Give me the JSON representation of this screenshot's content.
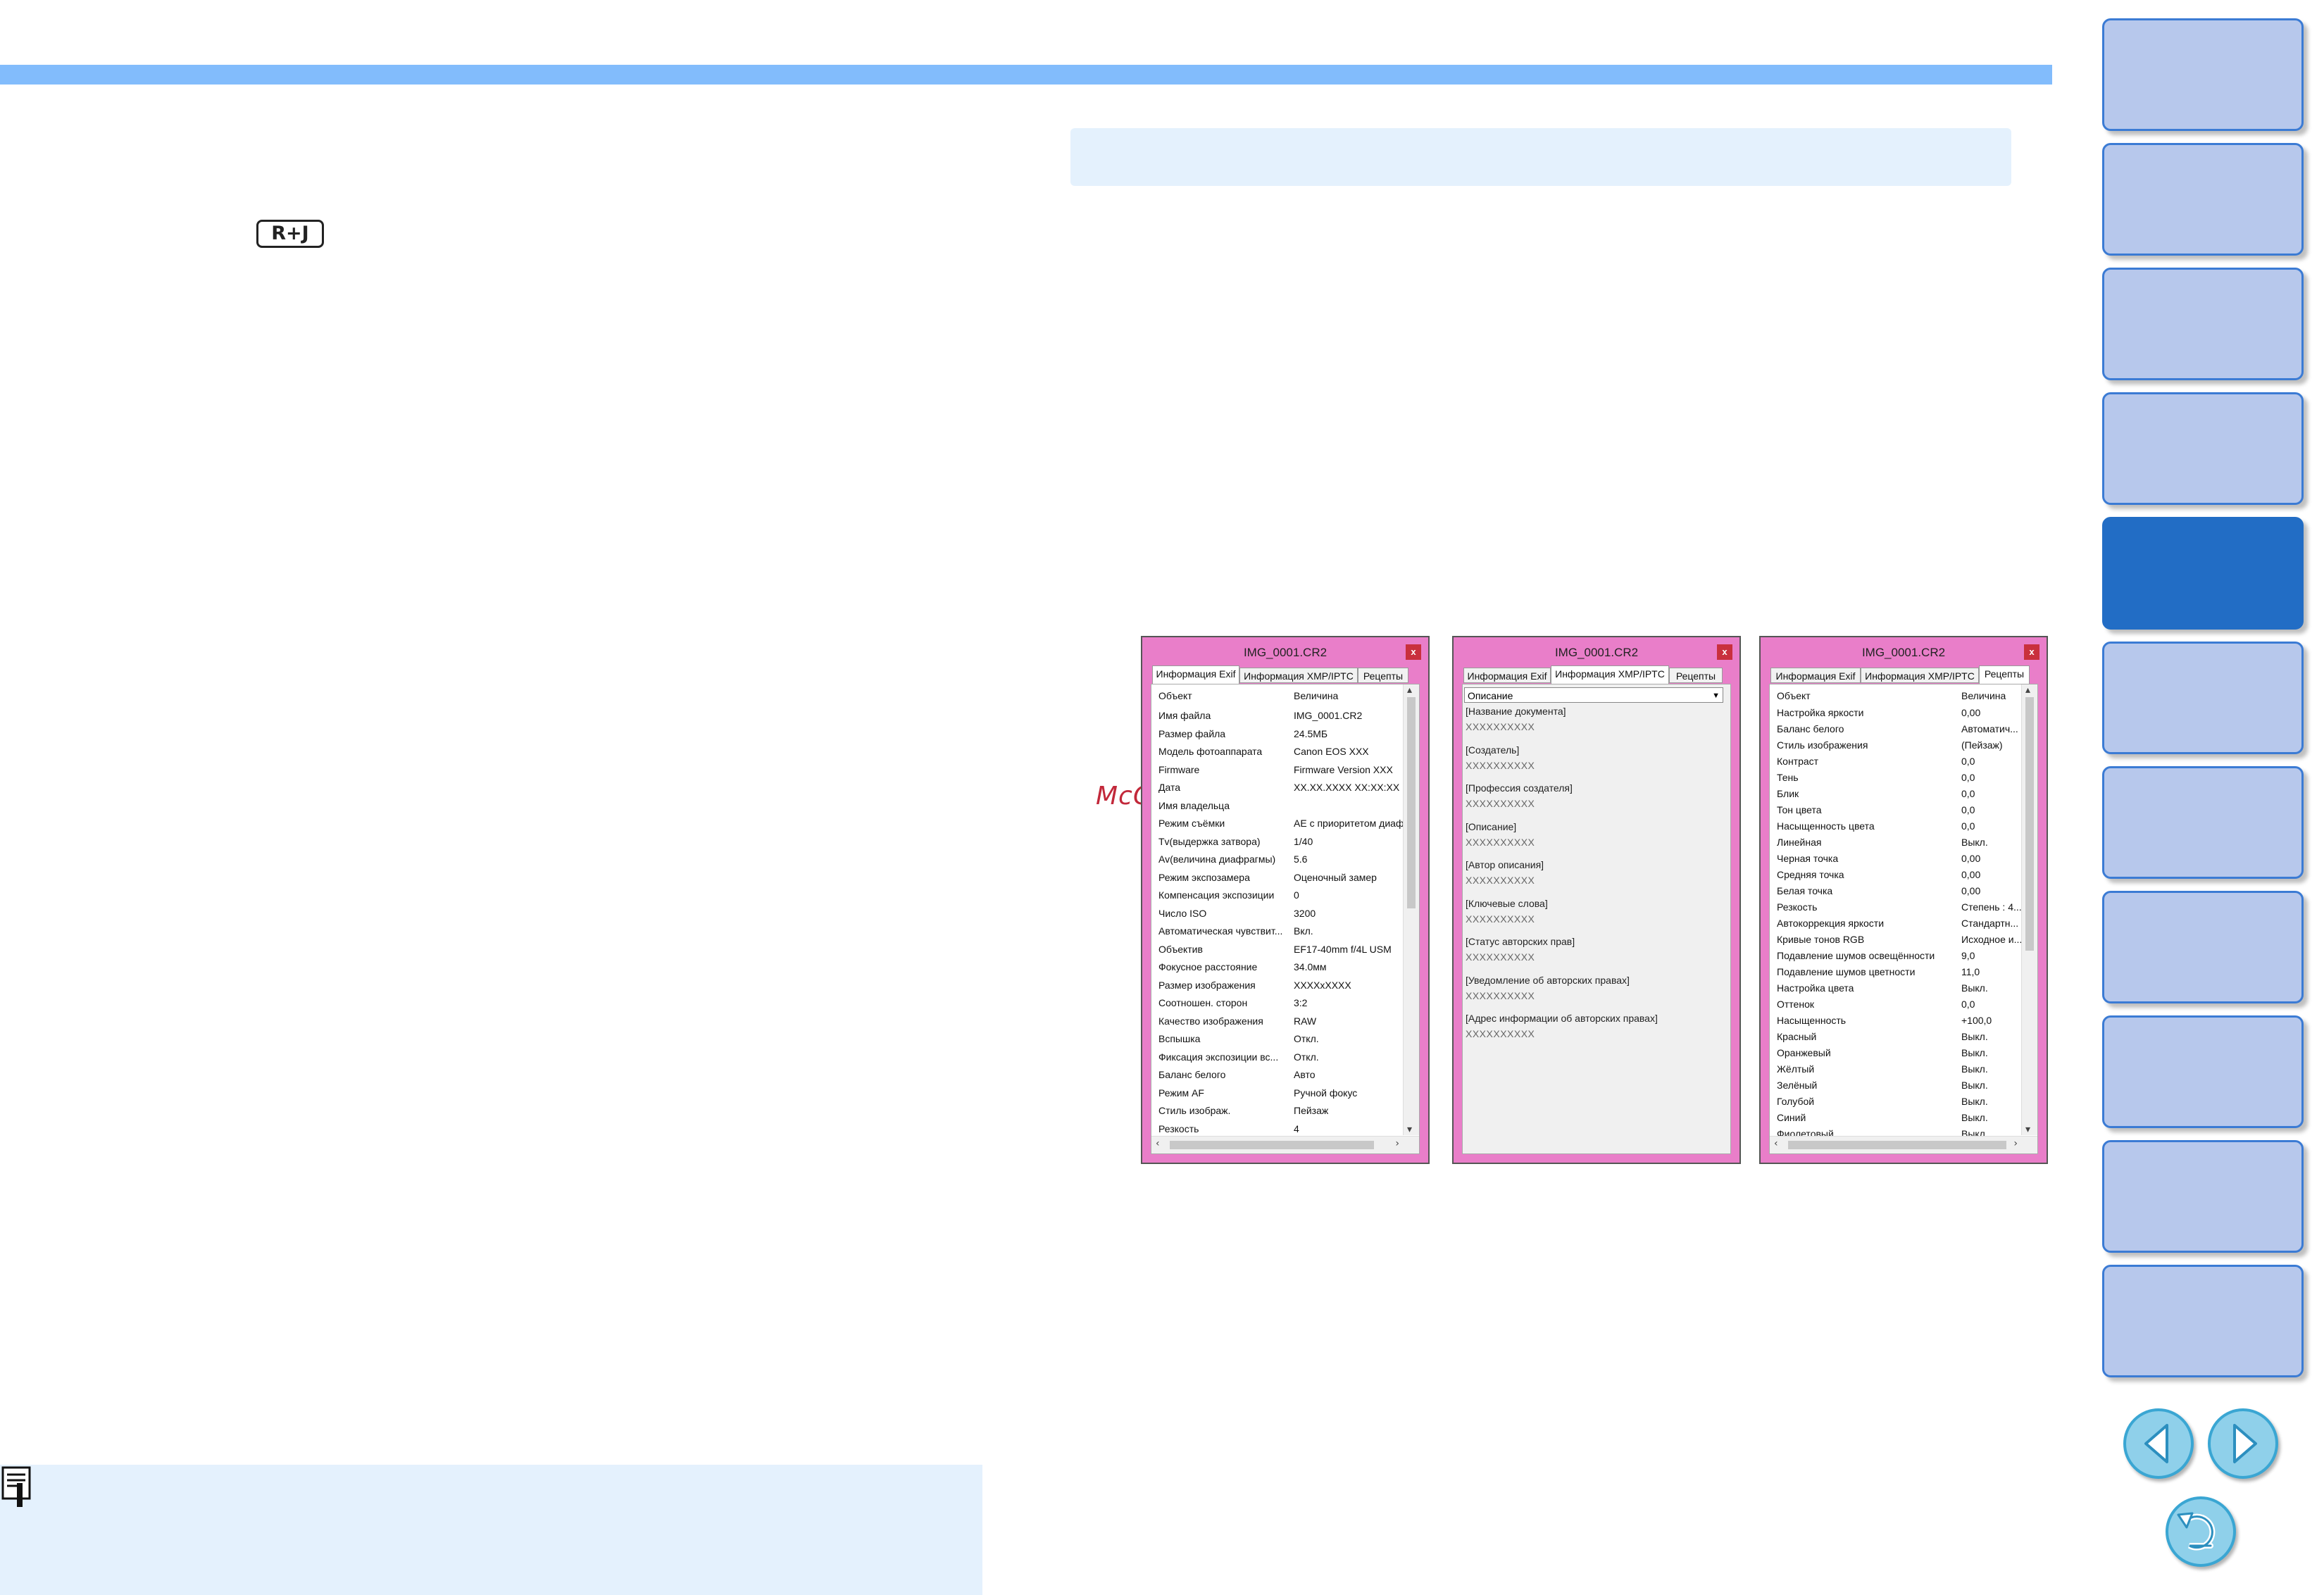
{
  "page": {
    "badge_label": "R+J",
    "watermark": "McGrp.Ru"
  },
  "colors": {
    "top_bar": "#82bcfc",
    "dialog_frame": "#e97ec9",
    "sidebar_button": "#b7c8ec",
    "sidebar_button_active": "#226dc5",
    "note_background": "#e4f1fd"
  },
  "sidebar": {
    "button_count": 11,
    "active_index": 4
  },
  "dialogs": {
    "exif": {
      "title": "IMG_0001.CR2",
      "close": "x",
      "tabs": [
        "Информация Exif",
        "Информация XMP/IPTC",
        "Рецепты"
      ],
      "header_key": "Объект",
      "header_value": "Величина",
      "rows": [
        {
          "k": "Имя файла",
          "v": "IMG_0001.CR2"
        },
        {
          "k": "Размер файла",
          "v": "24.5МБ"
        },
        {
          "k": "Модель фотоаппарата",
          "v": "Canon EOS XXX"
        },
        {
          "k": "Firmware",
          "v": "Firmware Version XXX"
        },
        {
          "k": "Дата",
          "v": "XX.XX.XXXX XX:XX:XX"
        },
        {
          "k": "Имя владельца",
          "v": ""
        },
        {
          "k": "Режим съёмки",
          "v": "AE с приоритетом диафр."
        },
        {
          "k": "Tv(выдержка затвора)",
          "v": "1/40"
        },
        {
          "k": "Av(величина диафрагмы)",
          "v": "5.6"
        },
        {
          "k": "Режим экспозамера",
          "v": "Оценочный замер"
        },
        {
          "k": "Компенсация экспозиции",
          "v": "0"
        },
        {
          "k": "Число ISO",
          "v": "3200"
        },
        {
          "k": "Автоматическая чувствит...",
          "v": "Вкл."
        },
        {
          "k": "Объектив",
          "v": "EF17-40mm f/4L USM"
        },
        {
          "k": "Фокусное расстояние",
          "v": "34.0мм"
        },
        {
          "k": "Размер изображения",
          "v": "XXXXxXXXX"
        },
        {
          "k": "Соотношен. сторон",
          "v": "3:2"
        },
        {
          "k": "Качество изображения",
          "v": "RAW"
        },
        {
          "k": "Вспышка",
          "v": "Откл."
        },
        {
          "k": "Фиксация экспозиции вс...",
          "v": "Откл."
        },
        {
          "k": "Баланс белого",
          "v": "Авто"
        },
        {
          "k": "Режим AF",
          "v": "Ручной фокус"
        },
        {
          "k": "Стиль изображ.",
          "v": "Пейзаж"
        },
        {
          "k": "Резкость",
          "v": "4"
        }
      ]
    },
    "xmp": {
      "title": "IMG_0001.CR2",
      "close": "x",
      "tabs": [
        "Информация Exif",
        "Информация XMP/IPTC",
        "Рецепты"
      ],
      "select_value": "Описание",
      "items": [
        {
          "t": "[Название документа]",
          "x": "XXXXXXXXXX"
        },
        {
          "t": "[Создатель]",
          "x": "XXXXXXXXXX"
        },
        {
          "t": "[Профессия создателя]",
          "x": "XXXXXXXXXX"
        },
        {
          "t": "[Описание]",
          "x": "XXXXXXXXXX"
        },
        {
          "t": "[Автор описания]",
          "x": "XXXXXXXXXX"
        },
        {
          "t": "[Ключевые слова]",
          "x": "XXXXXXXXXX"
        },
        {
          "t": "[Статус авторских прав]",
          "x": "XXXXXXXXXX"
        },
        {
          "t": "[Уведомление об авторских правах]",
          "x": "XXXXXXXXXX"
        },
        {
          "t": "[Адрес информации об авторских правах]",
          "x": "XXXXXXXXXX"
        }
      ]
    },
    "recipe": {
      "title": "IMG_0001.CR2",
      "close": "x",
      "tabs": [
        "Информация Exif",
        "Информация XMP/IPTC",
        "Рецепты"
      ],
      "header_key": "Объект",
      "header_value": "Величина",
      "rows": [
        {
          "k": "Настройка яркости",
          "v": "0,00"
        },
        {
          "k": "Баланс белого",
          "v": "Автоматич..."
        },
        {
          "k": "Стиль изображения",
          "v": "(Пейзаж)"
        },
        {
          "k": "Контраст",
          "v": "0,0"
        },
        {
          "k": "Тень",
          "v": "0,0"
        },
        {
          "k": "Блик",
          "v": "0,0"
        },
        {
          "k": "Тон цвета",
          "v": "0,0"
        },
        {
          "k": "Насыщенность цвета",
          "v": "0,0"
        },
        {
          "k": "Линейная",
          "v": "Выкл."
        },
        {
          "k": "Черная точка",
          "v": "0,00"
        },
        {
          "k": "Средняя точка",
          "v": "0,00"
        },
        {
          "k": "Белая точка",
          "v": "0,00"
        },
        {
          "k": "Резкость",
          "v": "Степень : 4..."
        },
        {
          "k": "Автокоррекция яркости",
          "v": "Стандартн..."
        },
        {
          "k": "Кривые тонов RGB",
          "v": "Исходное и..."
        },
        {
          "k": "Подавление шумов освещённости",
          "v": "9,0"
        },
        {
          "k": "Подавление шумов цветности",
          "v": "11,0"
        },
        {
          "k": "Настройка цвета",
          "v": "Выкл."
        },
        {
          "k": "Оттенок",
          "v": "0,0"
        },
        {
          "k": "Насыщенность",
          "v": "+100,0"
        },
        {
          "k": "Красный",
          "v": "Выкл."
        },
        {
          "k": "Оранжевый",
          "v": "Выкл."
        },
        {
          "k": "Жёлтый",
          "v": "Выкл."
        },
        {
          "k": "Зелёный",
          "v": "Выкл."
        },
        {
          "k": "Голубой",
          "v": "Выкл."
        },
        {
          "k": "Синий",
          "v": "Выкл."
        },
        {
          "k": "Фиолетовый",
          "v": "Выкл."
        }
      ]
    }
  },
  "icons": {
    "note": "memo-icon",
    "prev": "arrow-left-icon",
    "next": "arrow-right-icon",
    "back": "return-icon"
  }
}
